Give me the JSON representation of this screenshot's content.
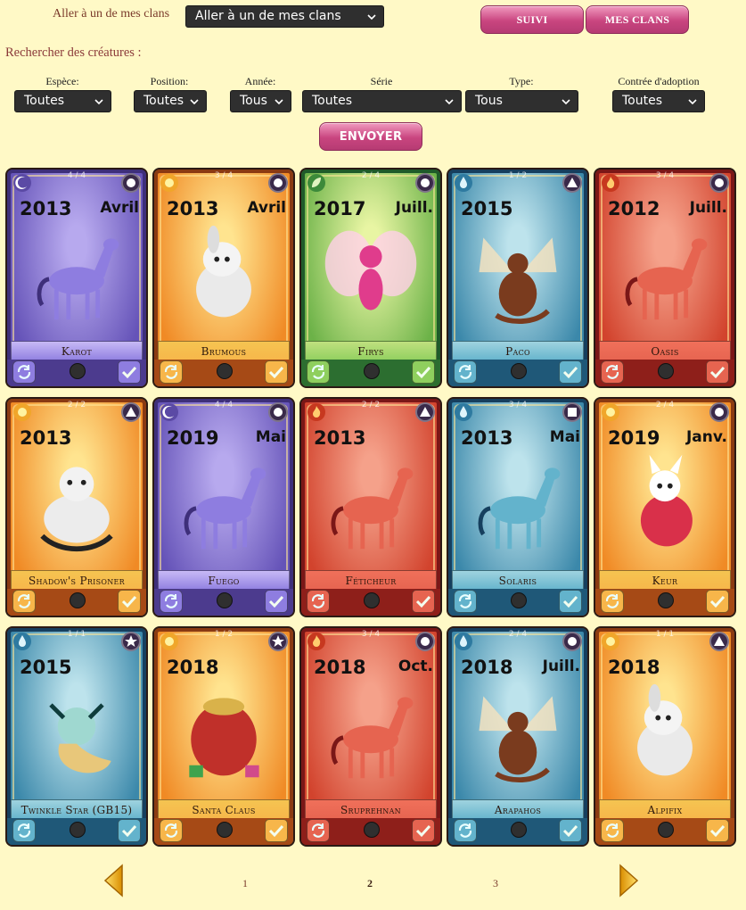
{
  "clan": {
    "label": "Aller à un de mes clans",
    "select_value": "Aller à un de mes clans"
  },
  "nav": {
    "suivi": "SUIVI",
    "mes_clans": "MES CLANS"
  },
  "search": {
    "title": "Rechercher des créatures :",
    "submit": "ENVOYER",
    "filters": [
      {
        "label": "Espèce:",
        "value": "Toutes"
      },
      {
        "label": "Position:",
        "value": "Toutes"
      },
      {
        "label": "Année:",
        "value": "Tous"
      },
      {
        "label": "Série",
        "value": "Toutes"
      },
      {
        "label": "Type:",
        "value": "Tous"
      },
      {
        "label": "Contrée d'adoption",
        "value": "Toutes"
      }
    ]
  },
  "cards": [
    {
      "name": "Karot",
      "year": "2013",
      "month": "Avril",
      "count": "4 / 4",
      "theme": "purple",
      "element": "moon",
      "rank": "circle",
      "art": "horse"
    },
    {
      "name": "Brumous",
      "year": "2013",
      "month": "Avril",
      "count": "3 / 4",
      "theme": "orange",
      "element": "sun",
      "rank": "circle",
      "art": "bunny"
    },
    {
      "name": "Firys",
      "year": "2017",
      "month": "Juill.",
      "count": "2 / 4",
      "theme": "green",
      "element": "leaf",
      "rank": "circle",
      "art": "fairy"
    },
    {
      "name": "Paco",
      "year": "2015",
      "month": "",
      "count": "1 / 2",
      "theme": "blue",
      "element": "water",
      "rank": "triangle",
      "art": "dragon"
    },
    {
      "name": "Oasis",
      "year": "2012",
      "month": "Juill.",
      "count": "3 / 4",
      "theme": "red",
      "element": "fire",
      "rank": "circle",
      "art": "horse"
    },
    {
      "name": "Shadow's Prisoner",
      "year": "2013",
      "month": "",
      "count": "2 / 2",
      "theme": "orange",
      "element": "sun",
      "rank": "triangle",
      "art": "bear"
    },
    {
      "name": "Fuego",
      "year": "2019",
      "month": "Mai",
      "count": "4 / 4",
      "theme": "purple",
      "element": "moon",
      "rank": "circle",
      "art": "horse"
    },
    {
      "name": "Féticheur",
      "year": "2013",
      "month": "",
      "count": "2 / 2",
      "theme": "red",
      "element": "fire",
      "rank": "triangle",
      "art": "horse"
    },
    {
      "name": "Solaris",
      "year": "2013",
      "month": "Mai",
      "count": "3 / 4",
      "theme": "blue",
      "element": "water",
      "rank": "square",
      "art": "horse"
    },
    {
      "name": "Keur",
      "year": "2019",
      "month": "Janv.",
      "count": "2 / 4",
      "theme": "orange",
      "element": "sun",
      "rank": "circle",
      "art": "cat"
    },
    {
      "name": "Twinkle Star (GB15)",
      "year": "2015",
      "month": "",
      "count": "1 / 1",
      "theme": "blue",
      "element": "water",
      "rank": "star",
      "art": "mermaid"
    },
    {
      "name": "Santa Claus",
      "year": "2018",
      "month": "",
      "count": "1 / 2",
      "theme": "orange",
      "element": "sun",
      "rank": "star",
      "art": "sack"
    },
    {
      "name": "Sruprehnan",
      "year": "2018",
      "month": "Oct.",
      "count": "3 / 4",
      "theme": "red",
      "element": "fire",
      "rank": "circle",
      "art": "horse"
    },
    {
      "name": "Arapahos",
      "year": "2018",
      "month": "Juill.",
      "count": "2 / 4",
      "theme": "blue",
      "element": "water",
      "rank": "circle",
      "art": "dragon"
    },
    {
      "name": "Alpifix",
      "year": "2018",
      "month": "",
      "count": "1 / 1",
      "theme": "orange",
      "element": "sun",
      "rank": "triangle",
      "art": "bunny"
    }
  ],
  "pager": {
    "pages": [
      "1",
      "2",
      "3"
    ],
    "current": "2"
  },
  "colors": {
    "background": "#fff9c6",
    "accent_pink": "#c9457f",
    "theme_purple": "#7b6ac8",
    "theme_orange": "#f0a133",
    "theme_green": "#86c25a",
    "theme_blue": "#3f86a8",
    "theme_red": "#d9503a"
  }
}
